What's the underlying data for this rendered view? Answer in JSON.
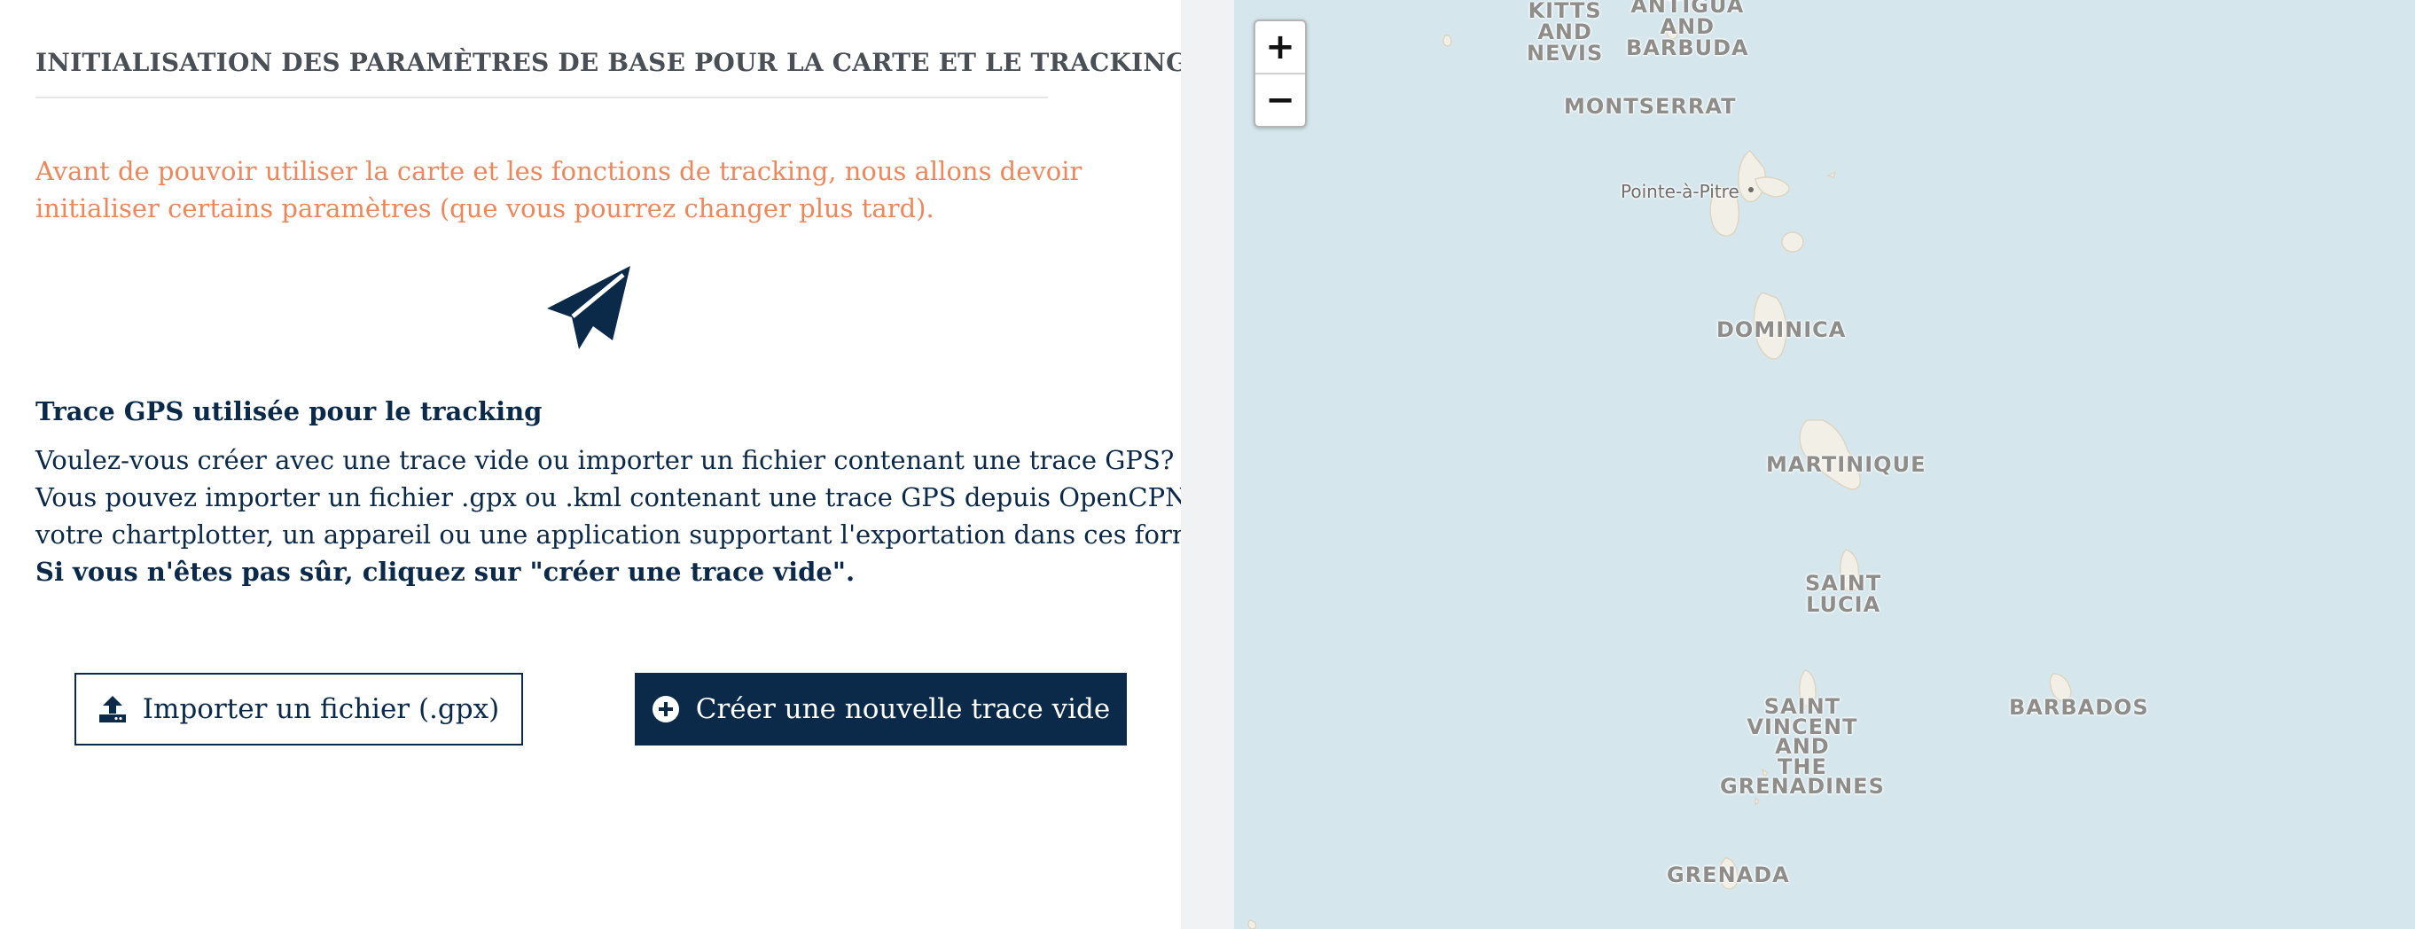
{
  "page": {
    "title": "INITIALISATION DES PARAMÈTRES DE BASE POUR LA CARTE ET LE TRACKING",
    "intro": "Avant de pouvoir utiliser la carte et les fonctions de tracking, nous allons devoir initialiser certains paramètres (que vous pourrez changer plus tard).",
    "icon": "paper-plane-icon"
  },
  "tracking": {
    "section_title": "Trace GPS utilisée pour le tracking",
    "lines": [
      "Voulez-vous créer avec une trace vide ou importer un fichier contenant une trace GPS?",
      "Vous pouvez importer un fichier .gpx ou .kml contenant une trace GPS depuis OpenCPN,",
      "votre chartplotter, un appareil ou une application supportant l'exportation dans ces formats."
    ],
    "strong_line": "Si vous n'êtes pas sûr, cliquez sur \"créer une trace vide\"."
  },
  "buttons": {
    "import_label": "Importer un fichier (.gpx)",
    "import_icon": "upload-icon",
    "create_label": "Créer une nouvelle trace vide",
    "create_icon": "plus-circle-icon"
  },
  "map": {
    "zoom_in": "+",
    "zoom_out": "−",
    "colors": {
      "sea": "#d5e7ec",
      "land": "#f2efe6"
    },
    "labels": {
      "kitts": [
        "KITTS",
        "AND",
        "NEVIS"
      ],
      "antigua": [
        "ANTIGUA",
        "AND",
        "BARBUDA"
      ],
      "montserrat": "MONTSERRAT",
      "pointe_a_pitre": "Pointe-à-Pitre",
      "dominica": "DOMINICA",
      "martinique": "MARTINIQUE",
      "saint_lucia": [
        "SAINT",
        "LUCIA"
      ],
      "saint_vincent": [
        "SAINT",
        "VINCENT",
        "AND",
        "THE",
        "GRENADINES"
      ],
      "barbados": "BARBADOS",
      "grenada": "GRENADA"
    }
  },
  "colors": {
    "primary": "#0b2a4a",
    "accent": "#f0875a",
    "title_gray": "#4a4f55"
  }
}
